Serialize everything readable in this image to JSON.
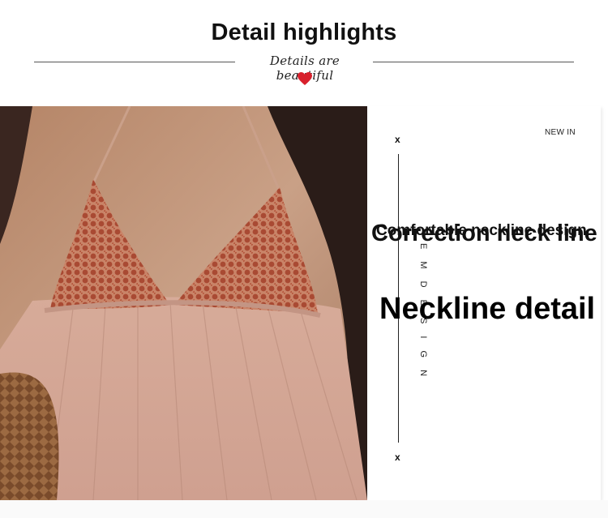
{
  "header": {
    "title": "Detail highlights",
    "script_text": "Details are beautiful"
  },
  "panel": {
    "new_in": "NEW IN",
    "x_mark": "x",
    "vertical_text": "E M D E S I G N",
    "headline_back": "Correction neck line",
    "headline_front": "Comfortable neckline design",
    "main_heading": "Neckline detail"
  },
  "colors": {
    "heart": "#d8202c",
    "dress_pink": "#d8aa98",
    "embroidery": "#b5583e",
    "hair": "#2a1c18"
  }
}
